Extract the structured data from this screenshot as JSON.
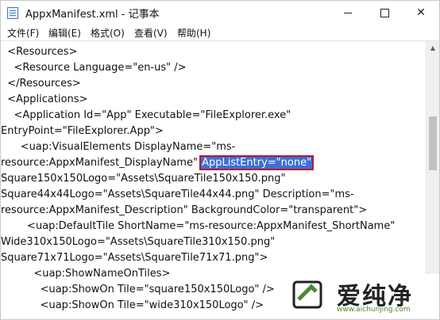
{
  "window": {
    "title": "AppxManifest.xml - 记事本",
    "icon": "notepad-icon"
  },
  "menu": [
    "文件(F)",
    "编辑(E)",
    "格式(O)",
    "查看(V)",
    "帮助(H)"
  ],
  "editor": {
    "lines": [
      "  <Resources>",
      "    <Resource Language=\"en-us\" />",
      "  </Resources>",
      "  <Applications>",
      "    <Application Id=\"App\" Executable=\"FileExplorer.exe\"",
      "EntryPoint=\"FileExplorer.App\">",
      "      <uap:VisualElements DisplayName=\"ms-",
      "resource:AppxManifest_DisplayName\" ",
      "Square150x150Logo=\"Assets\\SquareTile150x150.png\"",
      "Square44x44Logo=\"Assets\\SquareTile44x44.png\" Description=\"ms-",
      "resource:AppxManifest_Description\" BackgroundColor=\"transparent\">",
      "        <uap:DefaultTile ShortName=\"ms-resource:AppxManifest_ShortName\"",
      "Wide310x150Logo=\"Assets\\SquareTile310x150.png\"",
      "Square71x71Logo=\"Assets\\SquareTile71x71.png\">",
      "          <uap:ShowNameOnTiles>",
      "            <uap:ShowOn Tile=\"square150x150Logo\" />",
      "            <uap:ShowOn Tile=\"wide310x150Logo\" />"
    ],
    "selected_text": "AppListEntry=\"none\"",
    "selection_color": "#3b6fd6",
    "annotation_border_color": "#c0142a"
  },
  "watermark": {
    "brand": "爱纯净",
    "url": "www.aichunjing.com",
    "brand_color": "#4a8a2e"
  }
}
